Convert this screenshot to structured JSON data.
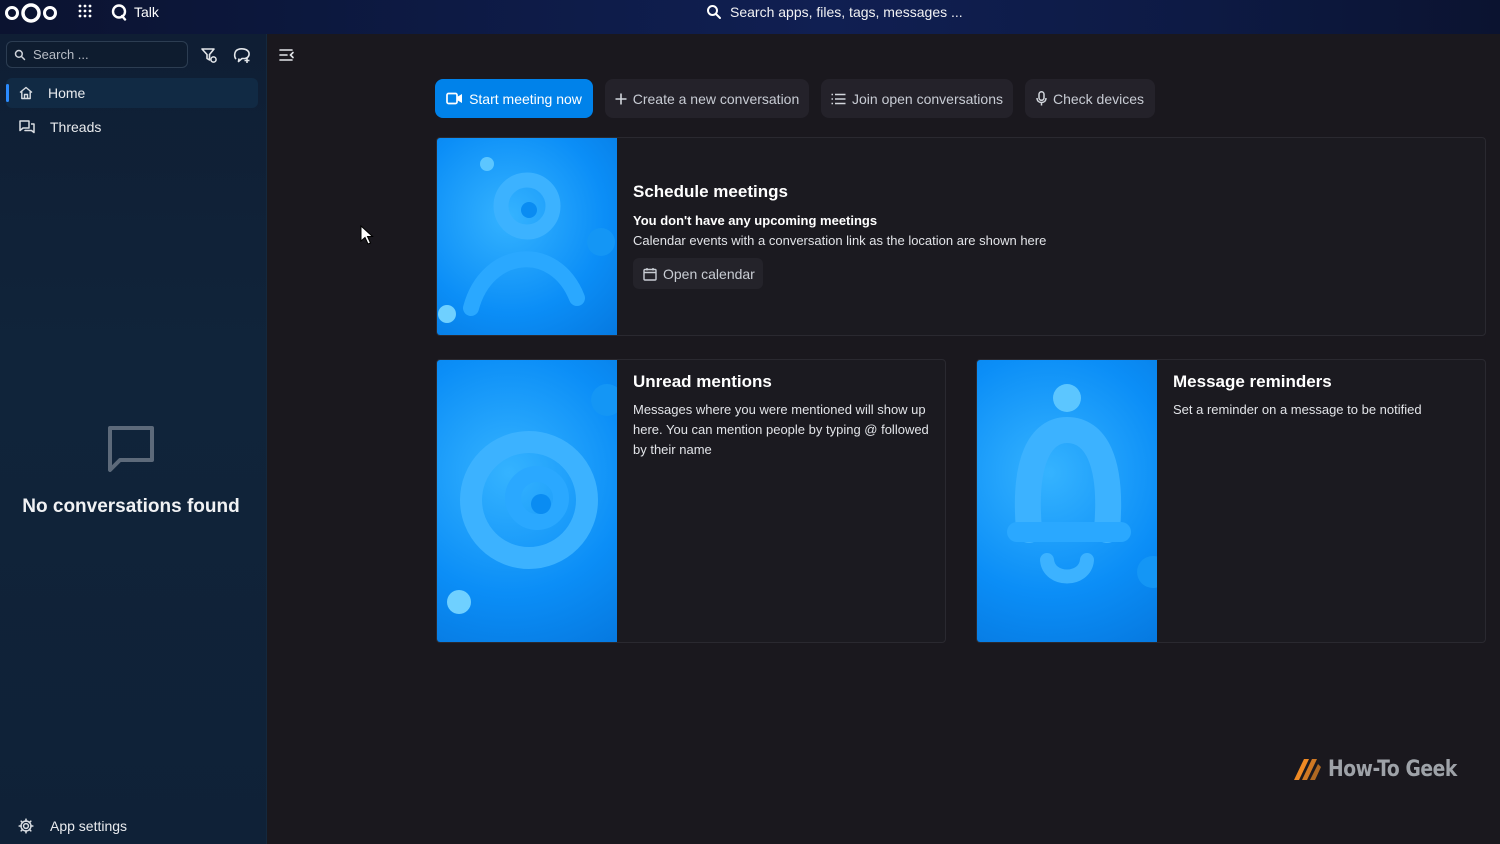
{
  "header": {
    "app_name": "Talk",
    "search_placeholder": "Search apps, files, tags, messages ..."
  },
  "sidebar": {
    "search_placeholder": "Search ...",
    "items": [
      {
        "label": "Home",
        "icon": "home-icon",
        "active": true
      },
      {
        "label": "Threads",
        "icon": "threads-icon",
        "active": false
      }
    ],
    "empty_text": "No conversations found",
    "app_settings_label": "App settings"
  },
  "toolbar": {
    "start_meeting": "Start meeting now",
    "create_conversation": "Create a new conversation",
    "join_open": "Join open conversations",
    "check_devices": "Check devices"
  },
  "cards": {
    "schedule": {
      "title": "Schedule meetings",
      "subtitle": "You don't have any upcoming meetings",
      "text": "Calendar events with a conversation link as the location are shown here",
      "button": "Open calendar"
    },
    "mentions": {
      "title": "Unread mentions",
      "text": "Messages where you were mentioned will show up here. You can mention people by typing @ followed by their name"
    },
    "reminders": {
      "title": "Message reminders",
      "text": "Set a reminder on a message to be notified"
    }
  },
  "watermark": "How-To Geek",
  "colors": {
    "primary": "#0082ea",
    "background": "#1a181e",
    "sidebar": "#10243a",
    "accent_orange": "#f08a24"
  }
}
